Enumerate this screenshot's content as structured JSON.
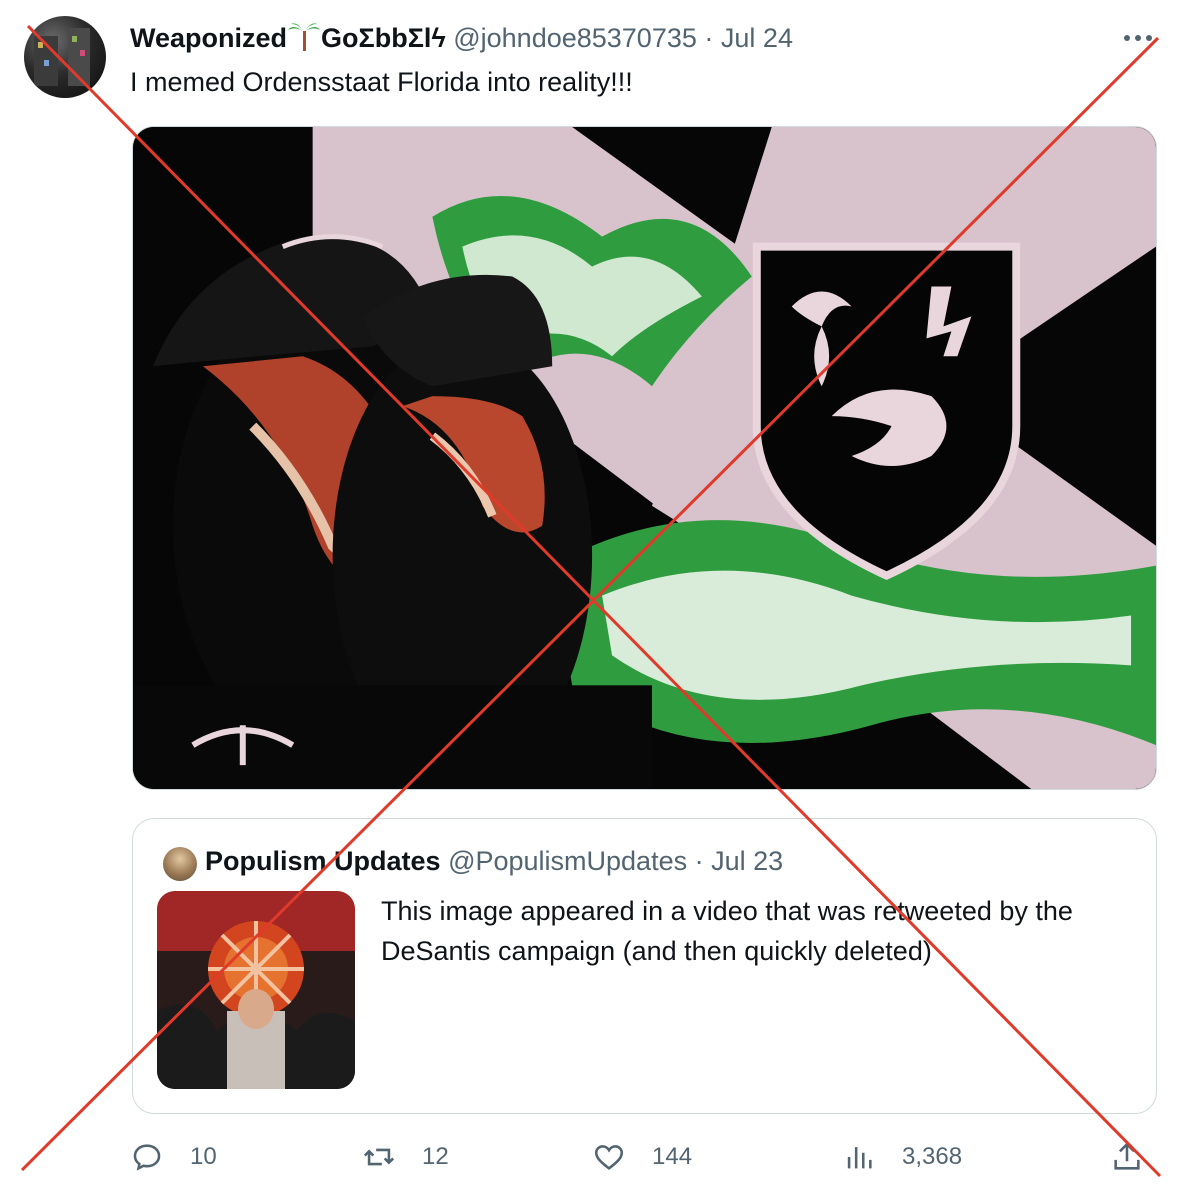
{
  "tweet": {
    "display_name_part1": "Weaponized",
    "display_name_part2": "GoΣbbΣlϟ",
    "handle": "@johndoe85370735",
    "separator": "·",
    "date": "Jul 24",
    "text": "I memed Ordensstaat Florida into reality!!!",
    "avatar_icon": "avatar-image",
    "more_icon": "more-options-icon",
    "palm_icon": "palm-tree-emoji"
  },
  "quote": {
    "display_name": "Populism Updates",
    "handle": "@PopulismUpdates",
    "separator": "·",
    "date": "Jul 23",
    "text": "This image appeared in a video that was retweeted by the DeSantis campaign (and then quickly deleted)"
  },
  "actions": {
    "replies": "10",
    "retweets": "12",
    "likes": "144",
    "views": "3,368",
    "icons": [
      "reply-icon",
      "retweet-icon",
      "like-icon",
      "views-icon",
      "share-icon"
    ]
  },
  "colors": {
    "text": "#0f1419",
    "secondary": "#536471",
    "border": "#cfd9de",
    "overlay_x": "#e03a2b"
  }
}
